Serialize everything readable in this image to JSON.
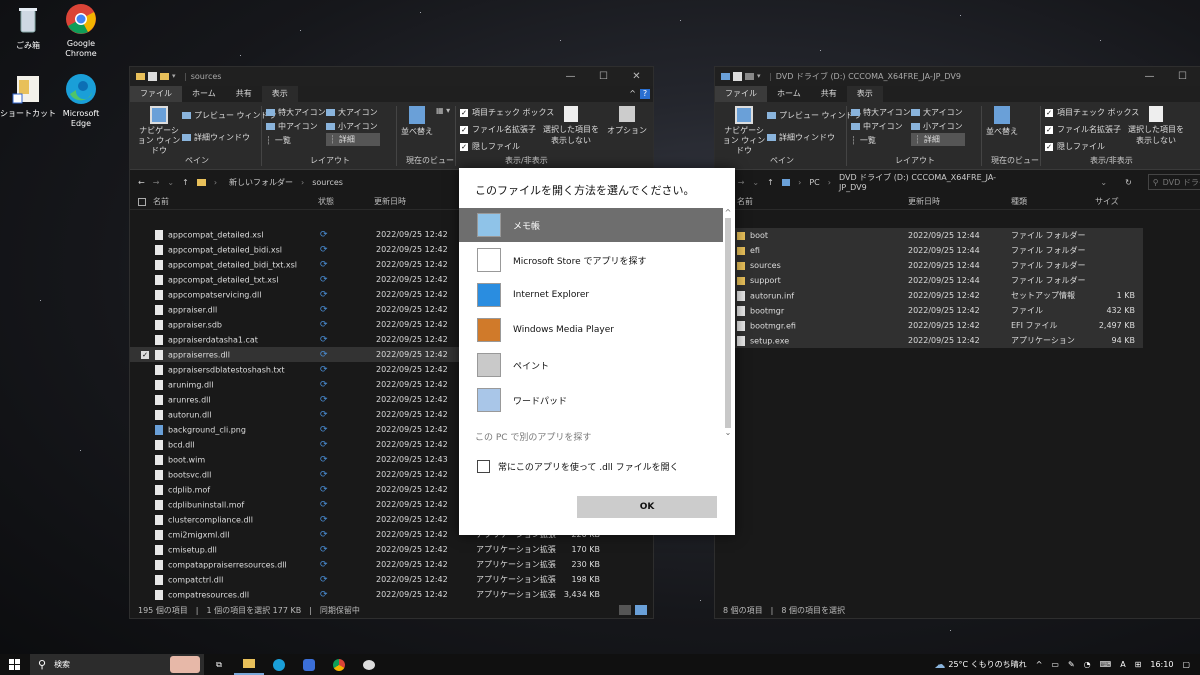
{
  "desktop": {
    "icons": [
      {
        "label": "ごみ箱",
        "icon": "recycle-bin-icon"
      },
      {
        "label": "Google Chrome",
        "icon": "chrome-icon"
      },
      {
        "label": "ショートカット",
        "icon": "shortcut-folder-icon"
      },
      {
        "label": "Microsoft Edge",
        "icon": "edge-icon"
      }
    ]
  },
  "left_window": {
    "title": "sources",
    "tabs": [
      "ファイル",
      "ホーム",
      "共有",
      "表示"
    ],
    "ribbon": {
      "nav_pane": "ナビゲーション ウィンドウ",
      "preview": "プレビュー ウィンドウ",
      "details_pane": "詳細ウィンドウ",
      "pane_group": "ペイン",
      "xl_icons": "特大アイコン",
      "l_icons": "大アイコン",
      "m_icons": "中アイコン",
      "s_icons": "小アイコン",
      "list": "一覧",
      "details": "詳細",
      "layout_group": "レイアウト",
      "sort": "並べ替え",
      "current_view_group": "現在のビュー",
      "item_check": "項目チェック ボックス",
      "file_ext": "ファイル名拡張子",
      "hidden": "隠しファイル",
      "hide_selected": "選択した項目を 表示しない",
      "options": "オプション",
      "showhide_group": "表示/非表示"
    },
    "path": [
      "新しいフォルダー",
      "sources"
    ],
    "columns": [
      "名前",
      "状態",
      "更新日時"
    ],
    "rows": [
      {
        "name": "appcompat_detailed.xsl",
        "date": "2022/09/25 12:42"
      },
      {
        "name": "appcompat_detailed_bidi.xsl",
        "date": "2022/09/25 12:42"
      },
      {
        "name": "appcompat_detailed_bidi_txt.xsl",
        "date": "2022/09/25 12:42"
      },
      {
        "name": "appcompat_detailed_txt.xsl",
        "date": "2022/09/25 12:42"
      },
      {
        "name": "appcompatservicing.dll",
        "date": "2022/09/25 12:42"
      },
      {
        "name": "appraiser.dll",
        "date": "2022/09/25 12:42"
      },
      {
        "name": "appraiser.sdb",
        "date": "2022/09/25 12:42"
      },
      {
        "name": "appraiserdatasha1.cat",
        "date": "2022/09/25 12:42"
      },
      {
        "name": "appraiserres.dll",
        "date": "2022/09/25 12:42"
      },
      {
        "name": "appraisersdblatestoshash.txt",
        "date": "2022/09/25 12:42"
      },
      {
        "name": "arunimg.dll",
        "date": "2022/09/25 12:42"
      },
      {
        "name": "arunres.dll",
        "date": "2022/09/25 12:42"
      },
      {
        "name": "autorun.dll",
        "date": "2022/09/25 12:42"
      },
      {
        "name": "background_cli.png",
        "date": "2022/09/25 12:42"
      },
      {
        "name": "bcd.dll",
        "date": "2022/09/25 12:42"
      },
      {
        "name": "boot.wim",
        "date": "2022/09/25 12:43"
      },
      {
        "name": "bootsvc.dll",
        "date": "2022/09/25 12:42"
      },
      {
        "name": "cdplib.mof",
        "date": "2022/09/25 12:42"
      },
      {
        "name": "cdplibuninstall.mof",
        "date": "2022/09/25 12:42"
      },
      {
        "name": "clustercompliance.dll",
        "date": "2022/09/25 12:42"
      },
      {
        "name": "cmi2migxml.dll",
        "date": "2022/09/25 12:42",
        "type": "アプリケーション拡張",
        "size": "220 KB"
      },
      {
        "name": "cmisetup.dll",
        "date": "2022/09/25 12:42",
        "type": "アプリケーション拡張",
        "size": "170 KB"
      },
      {
        "name": "compatappraiserresources.dll",
        "date": "2022/09/25 12:42",
        "type": "アプリケーション拡張",
        "size": "230 KB"
      },
      {
        "name": "compatctrl.dll",
        "date": "2022/09/25 12:42",
        "type": "アプリケーション拡張",
        "size": "198 KB"
      },
      {
        "name": "compatresources.dll",
        "date": "2022/09/25 12:42",
        "type": "アプリケーション拡張",
        "size": "3,434 KB"
      }
    ],
    "status": "195 個の項目　|　1 個の項目を選択 177 KB　|　同期保留中"
  },
  "right_window": {
    "title": "DVD ドライブ (D:) CCCOMA_X64FRE_JA-JP_DV9",
    "tabs": [
      "ファイル",
      "ホーム",
      "共有",
      "表示"
    ],
    "path": [
      "PC",
      "DVD ドライブ (D:) CCCOMA_X64FRE_JA-JP_DV9"
    ],
    "search_placeholder": "DVD ドライ",
    "columns": [
      "名前",
      "更新日時",
      "種類",
      "サイズ"
    ],
    "rows": [
      {
        "name": "boot",
        "date": "2022/09/25 12:44",
        "type": "ファイル フォルダー",
        "size": "",
        "kind": "folder"
      },
      {
        "name": "efi",
        "date": "2022/09/25 12:44",
        "type": "ファイル フォルダー",
        "size": "",
        "kind": "folder"
      },
      {
        "name": "sources",
        "date": "2022/09/25 12:44",
        "type": "ファイル フォルダー",
        "size": "",
        "kind": "folder"
      },
      {
        "name": "support",
        "date": "2022/09/25 12:44",
        "type": "ファイル フォルダー",
        "size": "",
        "kind": "folder"
      },
      {
        "name": "autorun.inf",
        "date": "2022/09/25 12:42",
        "type": "セットアップ情報",
        "size": "1 KB",
        "kind": "file"
      },
      {
        "name": "bootmgr",
        "date": "2022/09/25 12:42",
        "type": "ファイル",
        "size": "432 KB",
        "kind": "file"
      },
      {
        "name": "bootmgr.efi",
        "date": "2022/09/25 12:42",
        "type": "EFI ファイル",
        "size": "2,497 KB",
        "kind": "file"
      },
      {
        "name": "setup.exe",
        "date": "2022/09/25 12:42",
        "type": "アプリケーション",
        "size": "94 KB",
        "kind": "file"
      }
    ],
    "status": "8 個の項目　|　8 個の項目を選択"
  },
  "dialog": {
    "title": "このファイルを開く方法を選んでください。",
    "apps": [
      {
        "label": "メモ帳",
        "icon": "notepad-icon"
      },
      {
        "label": "Microsoft Store でアプリを探す",
        "icon": "store-icon"
      },
      {
        "label": "Internet Explorer",
        "icon": "ie-icon"
      },
      {
        "label": "Windows Media Player",
        "icon": "media-player-icon"
      },
      {
        "label": "ペイント",
        "icon": "paint-icon"
      },
      {
        "label": "ワードパッド",
        "icon": "wordpad-icon"
      }
    ],
    "more_link": "この PC で別のアプリを探す",
    "always_use": "常にこのアプリを使って .dll ファイルを開く",
    "ok": "OK"
  },
  "taskbar": {
    "search": "検索",
    "weather": "25°C くもりのち晴れ",
    "ime": "A",
    "time": "16:10"
  }
}
